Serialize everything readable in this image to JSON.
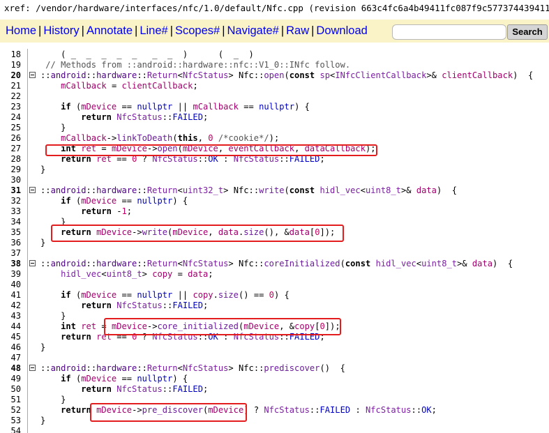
{
  "xref_path": "xref: /vendor/hardware/interfaces/nfc/1.0/default/Nfc.cpp (revision 663c4fc6a4b49411fc087f9c5773744394110843)",
  "nav": {
    "home": "Home",
    "history": "History",
    "annotate": "Annotate",
    "line": "Line#",
    "scopes": "Scopes#",
    "navigate": "Navigate#",
    "raw": "Raw",
    "download": "Download",
    "separator": "|"
  },
  "search": {
    "value": "",
    "button": "Search"
  },
  "lines": [
    {
      "n": "18",
      "bold": false,
      "fold": false,
      "code": "    ( _  _  _  _  _   _  _  )      (  _  )  "
    },
    {
      "n": "19",
      "bold": false,
      "fold": false,
      "code": " // Methods from ::android::hardware::nfc::V1_0::INfc follow."
    },
    {
      "n": "20",
      "bold": true,
      "fold": true,
      "code": "::android::hardware::Return<NfcStatus> Nfc::open(const sp<INfcClientCallback>& clientCallback)  {"
    },
    {
      "n": "21",
      "bold": false,
      "fold": false,
      "code": "    mCallback = clientCallback;"
    },
    {
      "n": "22",
      "bold": false,
      "fold": false,
      "code": ""
    },
    {
      "n": "23",
      "bold": false,
      "fold": false,
      "code": "    if (mDevice == nullptr || mCallback == nullptr) {"
    },
    {
      "n": "24",
      "bold": false,
      "fold": false,
      "code": "        return NfcStatus::FAILED;"
    },
    {
      "n": "25",
      "bold": false,
      "fold": false,
      "code": "    }"
    },
    {
      "n": "26",
      "bold": false,
      "fold": false,
      "code": "    mCallback->linkToDeath(this, 0 /*cookie*/);"
    },
    {
      "n": "27",
      "bold": false,
      "fold": false,
      "code": "    int ret = mDevice->open(mDevice, eventCallback, dataCallback);"
    },
    {
      "n": "28",
      "bold": false,
      "fold": false,
      "code": "    return ret == 0 ? NfcStatus::OK : NfcStatus::FAILED;"
    },
    {
      "n": "29",
      "bold": false,
      "fold": false,
      "code": "}"
    },
    {
      "n": "30",
      "bold": false,
      "fold": false,
      "code": ""
    },
    {
      "n": "31",
      "bold": true,
      "fold": true,
      "code": "::android::hardware::Return<uint32_t> Nfc::write(const hidl_vec<uint8_t>& data)  {"
    },
    {
      "n": "32",
      "bold": false,
      "fold": false,
      "code": "    if (mDevice == nullptr) {"
    },
    {
      "n": "33",
      "bold": false,
      "fold": false,
      "code": "        return -1;"
    },
    {
      "n": "34",
      "bold": false,
      "fold": false,
      "code": "    }"
    },
    {
      "n": "35",
      "bold": false,
      "fold": false,
      "code": "    return mDevice->write(mDevice, data.size(), &data[0]);"
    },
    {
      "n": "36",
      "bold": false,
      "fold": false,
      "code": "}"
    },
    {
      "n": "37",
      "bold": false,
      "fold": false,
      "code": ""
    },
    {
      "n": "38",
      "bold": true,
      "fold": true,
      "code": "::android::hardware::Return<NfcStatus> Nfc::coreInitialized(const hidl_vec<uint8_t>& data)  {"
    },
    {
      "n": "39",
      "bold": false,
      "fold": false,
      "code": "    hidl_vec<uint8_t> copy = data;"
    },
    {
      "n": "40",
      "bold": false,
      "fold": false,
      "code": ""
    },
    {
      "n": "41",
      "bold": false,
      "fold": false,
      "code": "    if (mDevice == nullptr || copy.size() == 0) {"
    },
    {
      "n": "42",
      "bold": false,
      "fold": false,
      "code": "        return NfcStatus::FAILED;"
    },
    {
      "n": "43",
      "bold": false,
      "fold": false,
      "code": "    }"
    },
    {
      "n": "44",
      "bold": false,
      "fold": false,
      "code": "    int ret = mDevice->core_initialized(mDevice, &copy[0]);"
    },
    {
      "n": "45",
      "bold": false,
      "fold": false,
      "code": "    return ret == 0 ? NfcStatus::OK : NfcStatus::FAILED;"
    },
    {
      "n": "46",
      "bold": false,
      "fold": false,
      "code": "}"
    },
    {
      "n": "47",
      "bold": false,
      "fold": false,
      "code": ""
    },
    {
      "n": "48",
      "bold": true,
      "fold": true,
      "code": "::android::hardware::Return<NfcStatus> Nfc::prediscover()  {"
    },
    {
      "n": "49",
      "bold": false,
      "fold": false,
      "code": "    if (mDevice == nullptr) {"
    },
    {
      "n": "50",
      "bold": false,
      "fold": false,
      "code": "        return NfcStatus::FAILED;"
    },
    {
      "n": "51",
      "bold": false,
      "fold": false,
      "code": "    }"
    },
    {
      "n": "52",
      "bold": false,
      "fold": false,
      "code": "    return mDevice->pre_discover(mDevice) ? NfcStatus::FAILED : NfcStatus::OK;"
    },
    {
      "n": "53",
      "bold": false,
      "fold": false,
      "code": "}"
    },
    {
      "n": "54",
      "bold": false,
      "fold": false,
      "code": ""
    }
  ],
  "highlight_color": "#e31d1d"
}
